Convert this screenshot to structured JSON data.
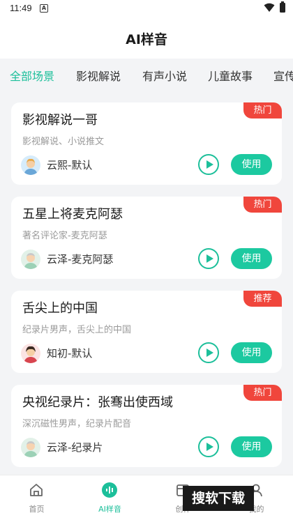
{
  "status_bar": {
    "time": "11:49",
    "notification_letter": "A"
  },
  "header": {
    "title": "AI样音"
  },
  "tabs": [
    {
      "label": "全部场景",
      "active": true
    },
    {
      "label": "影视解说"
    },
    {
      "label": "有声小说"
    },
    {
      "label": "儿童故事"
    },
    {
      "label": "宣传"
    }
  ],
  "cards": [
    {
      "title": "影视解说一哥",
      "badge": "热门",
      "subtitle": "影视解说、小说推文",
      "voice": "云熙-默认",
      "use_label": "使用"
    },
    {
      "title": "五星上将麦克阿瑟",
      "badge": "热门",
      "subtitle": "著名评论家-麦克阿瑟",
      "voice": "云泽-麦克阿瑟",
      "use_label": "使用"
    },
    {
      "title": "舌尖上的中国",
      "badge": "推荐",
      "subtitle": "纪录片男声，舌尖上的中国",
      "voice": "知初-默认",
      "use_label": "使用"
    },
    {
      "title": "央视纪录片：张骞出使西域",
      "badge": "热门",
      "subtitle": "深沉磁性男声，纪录片配音",
      "voice": "云泽-纪录片",
      "use_label": "使用"
    }
  ],
  "bottom_nav": [
    {
      "label": "首页"
    },
    {
      "label": "AI样音",
      "active": true
    },
    {
      "label": "创作"
    },
    {
      "label": "我的"
    }
  ],
  "watermark": "搜软下载",
  "colors": {
    "accent": "#1cbf9a",
    "badge": "#f0463c",
    "background": "#f3f4f6"
  }
}
